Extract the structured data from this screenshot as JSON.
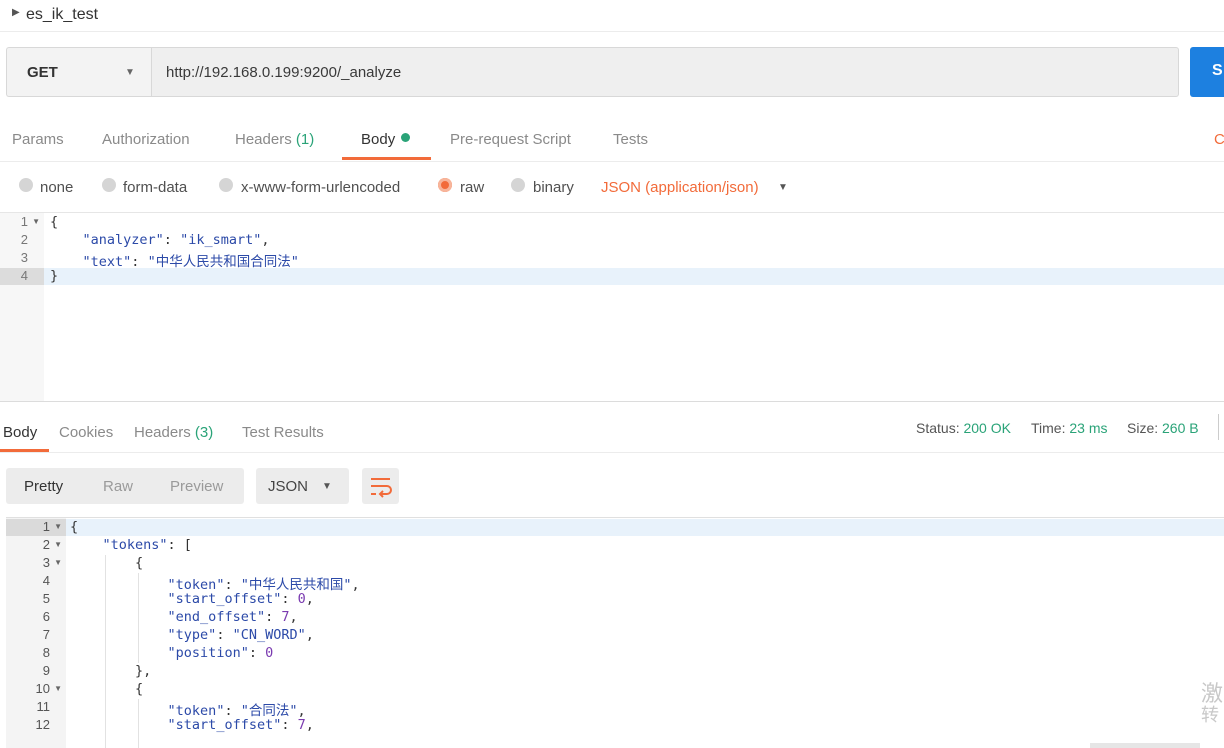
{
  "collection": {
    "title": "es_ik_test"
  },
  "request": {
    "method": "GET",
    "url": "http://192.168.0.199:9200/_analyze",
    "send_label": "S"
  },
  "request_tabs": {
    "params": "Params",
    "authorization": "Authorization",
    "headers": "Headers",
    "headers_count": "(1)",
    "body": "Body",
    "prerequest": "Pre-request Script",
    "tests": "Tests",
    "cookies_cut": "C"
  },
  "body_types": {
    "none": "none",
    "form_data": "form-data",
    "urlencoded": "x-www-form-urlencoded",
    "raw": "raw",
    "binary": "binary",
    "selected": "raw",
    "content_type": "JSON (application/json)"
  },
  "request_body": {
    "line_numbers": [
      "1",
      "2",
      "3",
      "4"
    ],
    "open_brace": "{",
    "analyzer_key": "\"analyzer\"",
    "analyzer_value": "\"ik_smart\"",
    "text_key": "\"text\"",
    "text_value": "\"中华人民共和国合同法\"",
    "close_brace": "}"
  },
  "response_tabs": {
    "body": "Body",
    "cookies": "Cookies",
    "headers": "Headers",
    "headers_count": "(3)",
    "test_results": "Test Results"
  },
  "response_meta": {
    "status_label": "Status:",
    "status_value": "200 OK",
    "time_label": "Time:",
    "time_value": "23 ms",
    "size_label": "Size:",
    "size_value": "260 B"
  },
  "response_view": {
    "pretty": "Pretty",
    "raw": "Raw",
    "preview": "Preview",
    "format": "JSON"
  },
  "response_body": {
    "line_numbers": [
      "1",
      "2",
      "3",
      "4",
      "5",
      "6",
      "7",
      "8",
      "9",
      "10",
      "11",
      "12"
    ],
    "l1": "{",
    "tokens_key": "\"tokens\"",
    "tokens_open": ": [",
    "obj_open": "{",
    "obj_close": "},",
    "k_token": "\"token\"",
    "v_token_1": "\"中华人民共和国\"",
    "k_start": "\"start_offset\"",
    "v_start_1": "0",
    "k_end": "\"end_offset\"",
    "v_end_1": "7",
    "k_type": "\"type\"",
    "v_type_1": "\"CN_WORD\"",
    "k_position": "\"position\"",
    "v_position_1": "0",
    "v_token_2": "\"合同法\"",
    "v_start_2": "7"
  },
  "watermark": {
    "line1": "激",
    "line2": "转"
  },
  "colors": {
    "accent_orange": "#f26b3a",
    "send_blue": "#1d80e0",
    "status_green": "#2aa378",
    "json_key_blue": "#2c4aa8",
    "json_number_purple": "#7a3ab0"
  }
}
